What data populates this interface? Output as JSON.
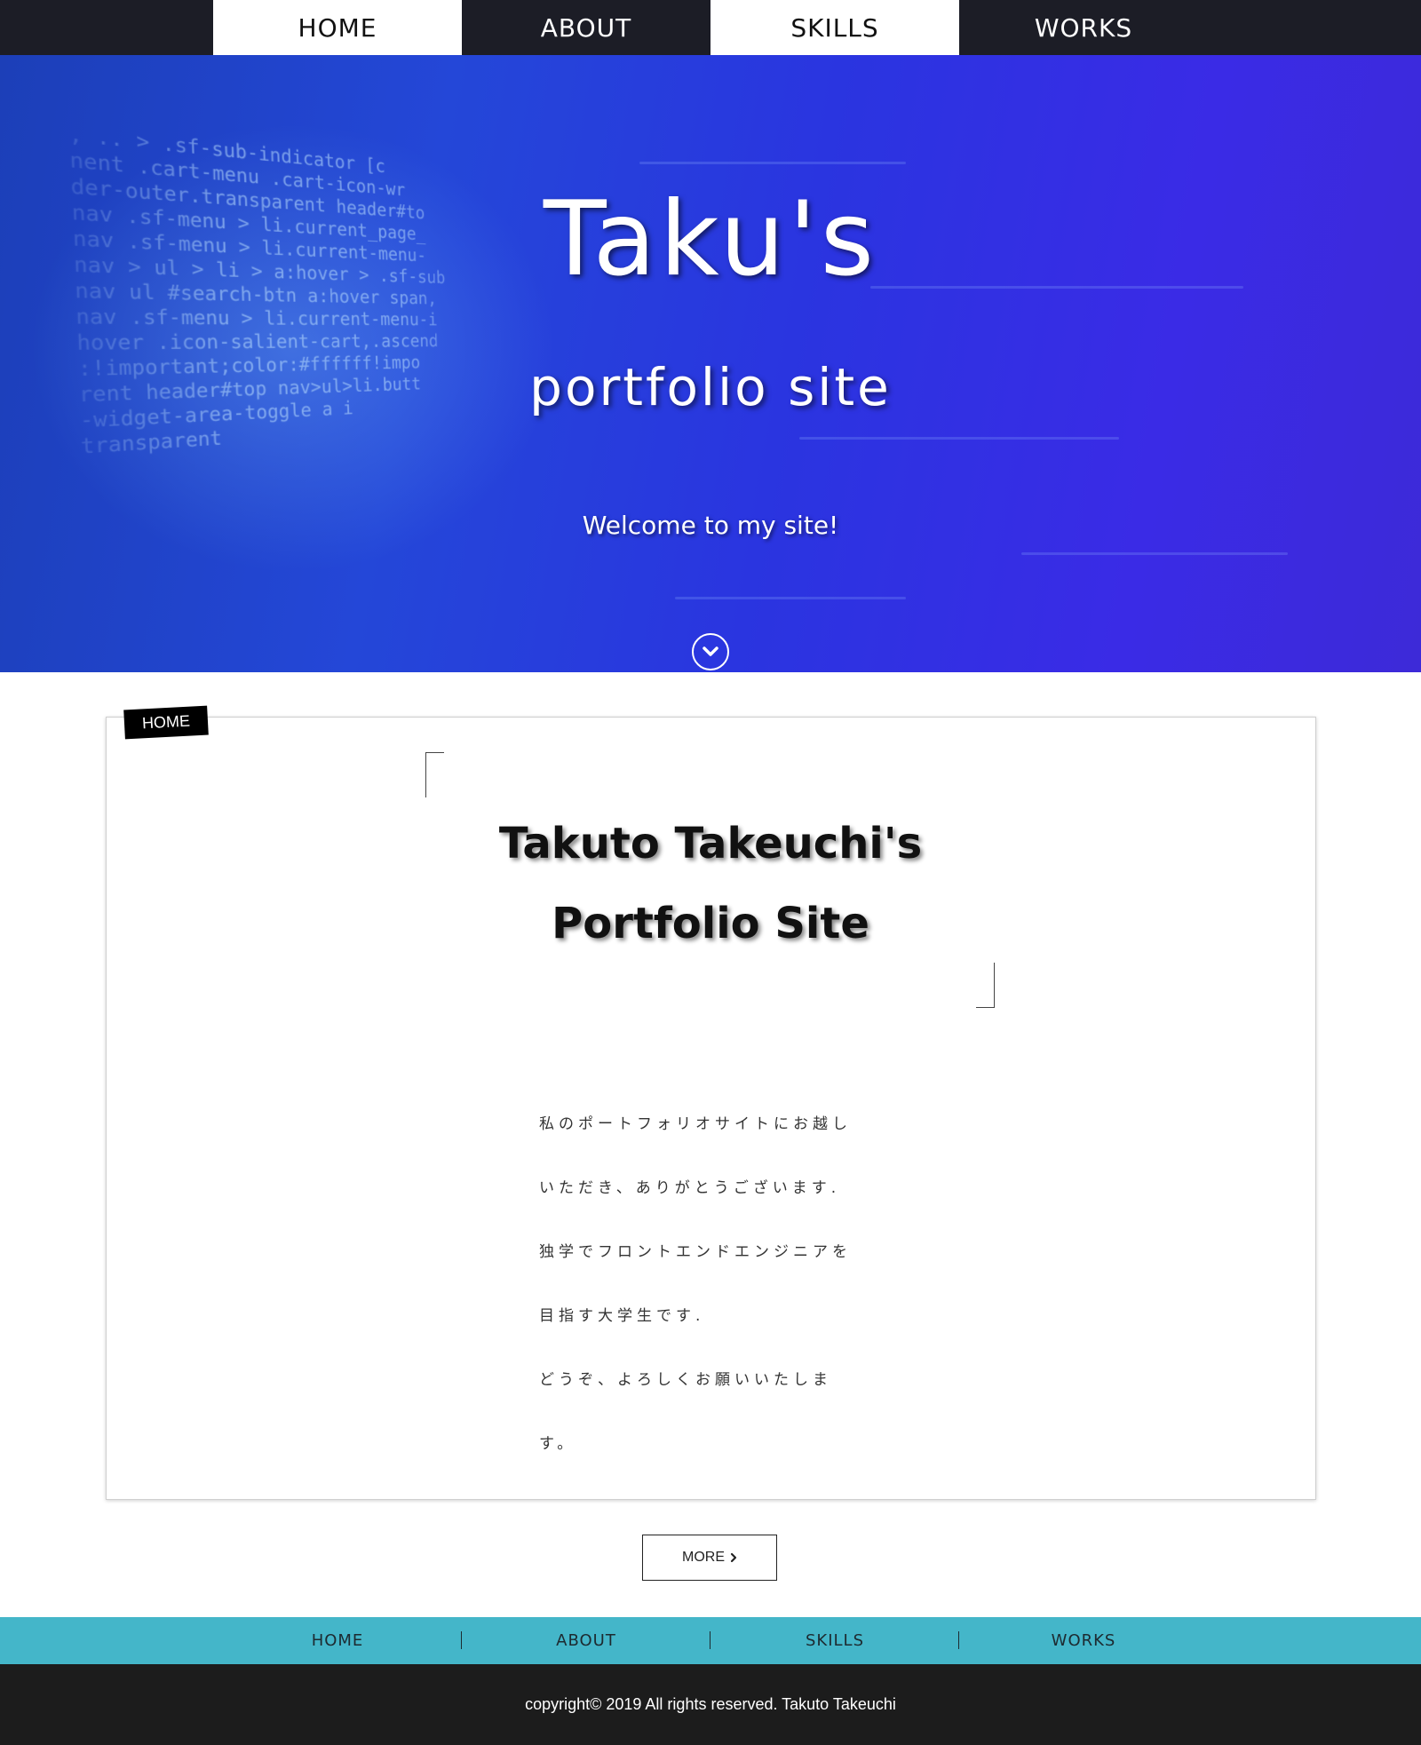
{
  "nav": {
    "items": [
      {
        "label": "HOME"
      },
      {
        "label": "ABOUT"
      },
      {
        "label": "SKILLS"
      },
      {
        "label": "WORKS"
      }
    ]
  },
  "hero": {
    "title": "Taku's",
    "subtitle": "portfolio site",
    "welcome": "Welcome to my site!",
    "code_lines": [
      "  , ..  > .sf-sub-indicator [c",
      "nent .cart-menu .cart-icon-wr",
      "der-outer.transparent header#to",
      "nav .sf-menu > li.current_page_",
      "nav .sf-menu > li.current-menu-",
      "nav > ul > li > a:hover > .sf-sub",
      "nav ul #search-btn a:hover span,",
      "nav .sf-menu > li.current-menu-i",
      "hover .icon-salient-cart,.ascend",
      ":!important;color:#ffffff!impo",
      "rent header#top nav>ul>li.butt",
      "   -widget-area-toggle a i",
      "            transparent"
    ]
  },
  "card": {
    "tag": "HOME",
    "heading_line1": "Takuto Takeuchi's",
    "heading_line2": "Portfolio Site",
    "text_lines": [
      "私のポートフォリオサイトにお越し",
      "いただき、ありがとうございます.",
      "独学でフロントエンドエンジニアを",
      "目指す大学生です.",
      "どうぞ、よろしくお願いいたしま",
      "す。"
    ]
  },
  "more_button": {
    "label": "MORE"
  },
  "footer_nav": {
    "items": [
      {
        "label": "HOME"
      },
      {
        "label": "ABOUT"
      },
      {
        "label": "SKILLS"
      },
      {
        "label": "WORKS"
      }
    ]
  },
  "footer": {
    "copyright": "copyright© 2019 All rights reserved. Takuto Takeuchi"
  },
  "colors": {
    "nav_bg": "#1c1d26",
    "hero_blue": "#2a35e0",
    "footer_nav_bg": "#44b6c9",
    "footer_bg": "#1c1c1c"
  },
  "icons": {
    "scroll_down": "chevron-down-icon",
    "more_arrow": "chevron-right-icon"
  }
}
